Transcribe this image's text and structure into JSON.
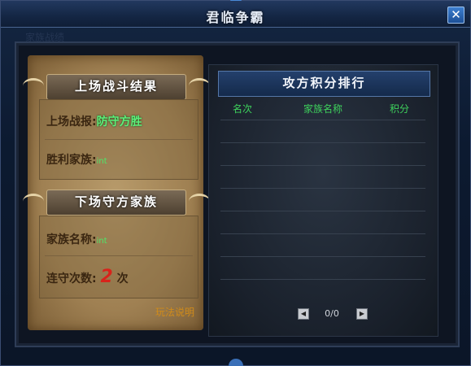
{
  "window": {
    "title": "君临争霸",
    "close_label": "✕",
    "ghost_text": "家族战绩"
  },
  "left": {
    "battle_banner": "上场战斗结果",
    "report_label": "上场战报:",
    "report_value": "防守方胜",
    "winner_label": "胜利家族:",
    "winner_value": "int",
    "defender_banner": "下场守方家族",
    "family_label": "家族名称:",
    "family_value": "int",
    "streak_label": "连守次数:",
    "streak_value": "2",
    "streak_unit": "次",
    "guide_link": "玩法说明"
  },
  "ranking": {
    "title": "攻方积分排行",
    "columns": [
      "名次",
      "家族名称",
      "积分"
    ],
    "rows": [],
    "page": "0/0",
    "prev_label": "◀",
    "next_label": "▶"
  },
  "colors": {
    "accent": "#3ed25c",
    "highlight": "#d8231b",
    "link": "#d08b1a"
  }
}
